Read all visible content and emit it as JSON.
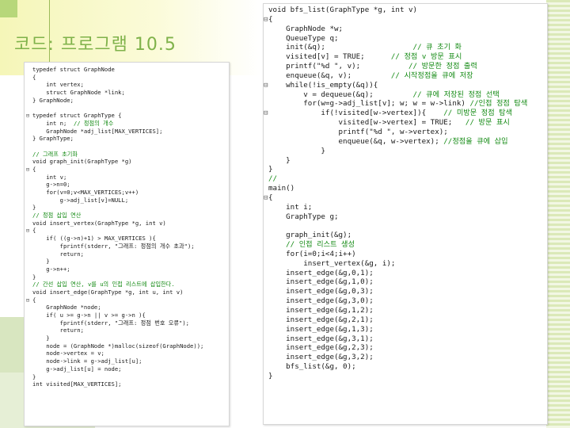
{
  "slide": {
    "title": "코드: 프로그램 10.5"
  },
  "colors": {
    "title": "#7fb24a",
    "accent_green": "#9bbb59",
    "accent_yellow": "#f5f6b8",
    "comment": "#138a13",
    "code_text": "#1a1a1a"
  },
  "left_code": {
    "lines": [
      {
        "marker": "",
        "text": "typedef struct GraphNode",
        "comment": ""
      },
      {
        "marker": "",
        "text": "{",
        "comment": ""
      },
      {
        "marker": "",
        "text": "    int vertex;",
        "comment": ""
      },
      {
        "marker": "",
        "text": "    struct GraphNode *link;",
        "comment": ""
      },
      {
        "marker": "",
        "text": "} GraphNode;",
        "comment": ""
      },
      {
        "marker": "",
        "text": "",
        "comment": ""
      },
      {
        "marker": "⊟",
        "text": "typedef struct GraphType {",
        "comment": ""
      },
      {
        "marker": "",
        "text": "    int n;  ",
        "comment": "// 정점의 개수"
      },
      {
        "marker": "",
        "text": "    GraphNode *adj_list[MAX_VERTICES];",
        "comment": ""
      },
      {
        "marker": "",
        "text": "} GraphType;",
        "comment": ""
      },
      {
        "marker": "",
        "text": "",
        "comment": ""
      },
      {
        "marker": "",
        "text": "",
        "comment": "// 그래프 초기화"
      },
      {
        "marker": "",
        "text": "void graph_init(GraphType *g)",
        "comment": ""
      },
      {
        "marker": "⊟",
        "text": "{",
        "comment": ""
      },
      {
        "marker": "",
        "text": "    int v;",
        "comment": ""
      },
      {
        "marker": "",
        "text": "    g->n=0;",
        "comment": ""
      },
      {
        "marker": "",
        "text": "    for(v=0;v<MAX_VERTICES;v++)",
        "comment": ""
      },
      {
        "marker": "",
        "text": "        g->adj_list[v]=NULL;",
        "comment": ""
      },
      {
        "marker": "",
        "text": "}",
        "comment": ""
      },
      {
        "marker": "",
        "text": "",
        "comment": "// 정점 삽입 연산"
      },
      {
        "marker": "",
        "text": "void insert_vertex(GraphType *g, int v)",
        "comment": ""
      },
      {
        "marker": "⊟",
        "text": "{",
        "comment": ""
      },
      {
        "marker": "",
        "text": "    if( ((g->n)+1) > MAX_VERTICES ){",
        "comment": ""
      },
      {
        "marker": "",
        "text": "        fprintf(stderr, \"그래프: 정점의 개수 초과\");",
        "comment": ""
      },
      {
        "marker": "",
        "text": "        return;",
        "comment": ""
      },
      {
        "marker": "",
        "text": "    }",
        "comment": ""
      },
      {
        "marker": "",
        "text": "    g->n++;",
        "comment": ""
      },
      {
        "marker": "",
        "text": "}",
        "comment": ""
      },
      {
        "marker": "",
        "text": "",
        "comment": "// 간선 삽입 연산, v를 u의 인접 리스트에 삽입한다."
      },
      {
        "marker": "",
        "text": "void insert_edge(GraphType *g, int u, int v)",
        "comment": ""
      },
      {
        "marker": "⊟",
        "text": "{",
        "comment": ""
      },
      {
        "marker": "",
        "text": "    GraphNode *node;",
        "comment": ""
      },
      {
        "marker": "",
        "text": "    if( u >= g->n || v >= g->n ){",
        "comment": ""
      },
      {
        "marker": "",
        "text": "        fprintf(stderr, \"그래프: 정점 번호 오류\");",
        "comment": ""
      },
      {
        "marker": "",
        "text": "        return;",
        "comment": ""
      },
      {
        "marker": "",
        "text": "    }",
        "comment": ""
      },
      {
        "marker": "",
        "text": "    node = (GraphNode *)malloc(sizeof(GraphNode));",
        "comment": ""
      },
      {
        "marker": "",
        "text": "    node->vertex = v;",
        "comment": ""
      },
      {
        "marker": "",
        "text": "    node->link = g->adj_list[u];",
        "comment": ""
      },
      {
        "marker": "",
        "text": "    g->adj_list[u] = node;",
        "comment": ""
      },
      {
        "marker": "",
        "text": "}",
        "comment": ""
      },
      {
        "marker": "",
        "text": "int visited[MAX_VERTICES];",
        "comment": ""
      }
    ]
  },
  "right_code": {
    "lines": [
      {
        "marker": "",
        "text": "void bfs_list(GraphType *g, int v)",
        "comment": ""
      },
      {
        "marker": "⊟",
        "text": "{",
        "comment": ""
      },
      {
        "marker": "",
        "text": "    GraphNode *w;",
        "comment": ""
      },
      {
        "marker": "",
        "text": "    QueueType q;",
        "comment": ""
      },
      {
        "marker": "",
        "text": "    init(&q);                    ",
        "comment": "// 큐 초기 화"
      },
      {
        "marker": "",
        "text": "    visited[v] = TRUE;      ",
        "comment": "// 정점 v 방문 표시"
      },
      {
        "marker": "",
        "text": "    printf(\"%d \", v);           ",
        "comment": "// 방문한 정점 출력"
      },
      {
        "marker": "",
        "text": "    enqueue(&q, v);         ",
        "comment": "// 시작정점을 큐에 저장"
      },
      {
        "marker": "⊟",
        "text": "    while(!is_empty(&q)){",
        "comment": ""
      },
      {
        "marker": "",
        "text": "        v = dequeue(&q);         ",
        "comment": "// 큐에 저장된 정점 선택"
      },
      {
        "marker": "",
        "text": "        for(w=g->adj_list[v]; w; w = w->link) ",
        "comment": "//인접 정점 탐색"
      },
      {
        "marker": "⊟",
        "text": "            if(!visited[w->vertex]){    ",
        "comment": "// 미방문 정점 탐색"
      },
      {
        "marker": "",
        "text": "                visited[w->vertex] = TRUE;   ",
        "comment": "// 방문 표시"
      },
      {
        "marker": "",
        "text": "                printf(\"%d \", w->vertex);",
        "comment": ""
      },
      {
        "marker": "",
        "text": "                enqueue(&q, w->vertex); ",
        "comment": "//정점을 큐에 삽입"
      },
      {
        "marker": "",
        "text": "            }",
        "comment": ""
      },
      {
        "marker": "",
        "text": "    }",
        "comment": ""
      },
      {
        "marker": "",
        "text": "}",
        "comment": ""
      },
      {
        "marker": "",
        "text": "",
        "comment": "//"
      },
      {
        "marker": "",
        "text": "main()",
        "comment": ""
      },
      {
        "marker": "⊟",
        "text": "{",
        "comment": ""
      },
      {
        "marker": "",
        "text": "    int i;",
        "comment": ""
      },
      {
        "marker": "",
        "text": "    GraphType g;",
        "comment": ""
      },
      {
        "marker": "",
        "text": "",
        "comment": ""
      },
      {
        "marker": "",
        "text": "    graph_init(&g);",
        "comment": ""
      },
      {
        "marker": "",
        "text": "    ",
        "comment": "// 인접 리스트 생성"
      },
      {
        "marker": "",
        "text": "    for(i=0;i<4;i++)",
        "comment": ""
      },
      {
        "marker": "",
        "text": "        insert_vertex(&g, i);",
        "comment": ""
      },
      {
        "marker": "",
        "text": "    insert_edge(&g,0,1);",
        "comment": ""
      },
      {
        "marker": "",
        "text": "    insert_edge(&g,1,0);",
        "comment": ""
      },
      {
        "marker": "",
        "text": "    insert_edge(&g,0,3);",
        "comment": ""
      },
      {
        "marker": "",
        "text": "    insert_edge(&g,3,0);",
        "comment": ""
      },
      {
        "marker": "",
        "text": "    insert_edge(&g,1,2);",
        "comment": ""
      },
      {
        "marker": "",
        "text": "    insert_edge(&g,2,1);",
        "comment": ""
      },
      {
        "marker": "",
        "text": "    insert_edge(&g,1,3);",
        "comment": ""
      },
      {
        "marker": "",
        "text": "    insert_edge(&g,3,1);",
        "comment": ""
      },
      {
        "marker": "",
        "text": "    insert_edge(&g,2,3);",
        "comment": ""
      },
      {
        "marker": "",
        "text": "    insert_edge(&g,3,2);",
        "comment": ""
      },
      {
        "marker": "",
        "text": "    bfs_list(&g, 0);",
        "comment": ""
      },
      {
        "marker": "",
        "text": "}",
        "comment": ""
      }
    ]
  }
}
